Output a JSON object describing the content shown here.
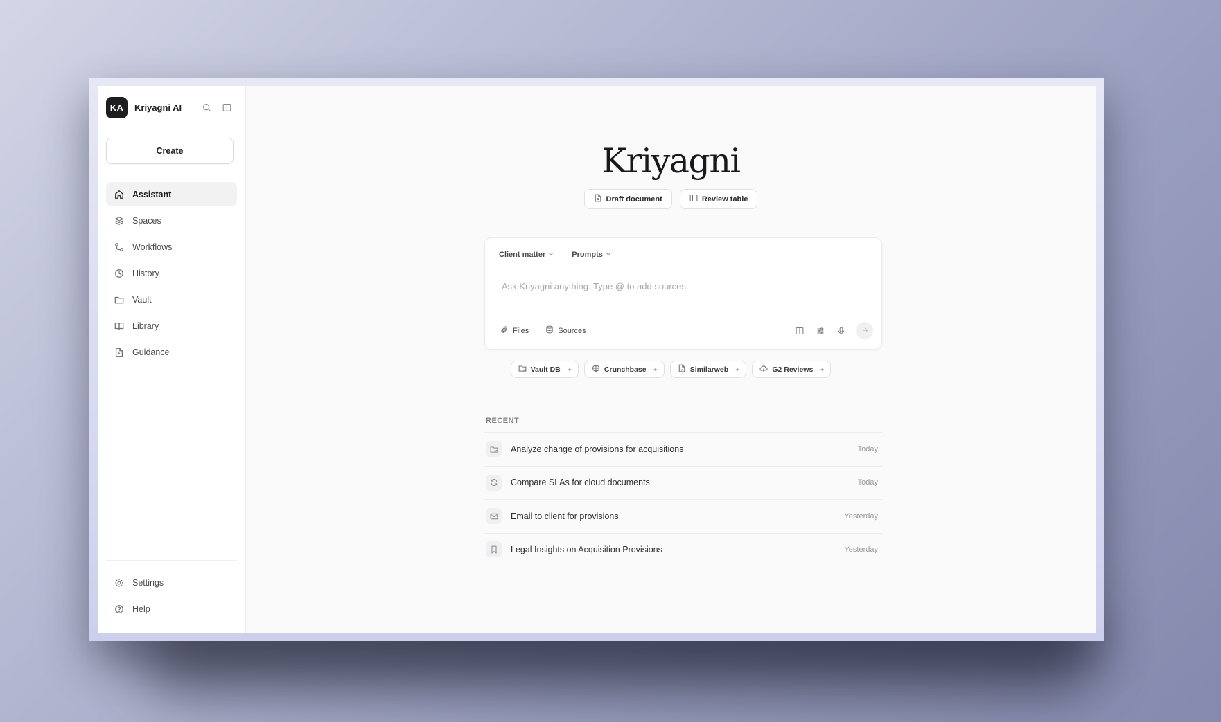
{
  "app": {
    "brand_initials": "KA",
    "brand_name": "Kriyagni AI",
    "hero_title": "Kriyagni"
  },
  "sidebar": {
    "create_label": "Create",
    "items": [
      {
        "label": "Assistant",
        "icon": "home-icon",
        "active": true
      },
      {
        "label": "Spaces",
        "icon": "layers-icon"
      },
      {
        "label": "Workflows",
        "icon": "workflow-icon"
      },
      {
        "label": "History",
        "icon": "clock-icon"
      },
      {
        "label": "Vault",
        "icon": "folder-icon"
      },
      {
        "label": "Library",
        "icon": "book-icon"
      },
      {
        "label": "Guidance",
        "icon": "file-guidance-icon"
      }
    ],
    "bottom": [
      {
        "label": "Settings",
        "icon": "gear-icon"
      },
      {
        "label": "Help",
        "icon": "help-icon"
      }
    ]
  },
  "quick_actions": [
    {
      "label": "Draft document",
      "icon": "document-icon"
    },
    {
      "label": "Review table",
      "icon": "table-icon"
    }
  ],
  "composer": {
    "client_matter": "Client matter",
    "prompts": "Prompts",
    "placeholder": "Ask Kriyagni anything. Type @ to add sources.",
    "files": "Files",
    "sources": "Sources"
  },
  "source_chips": [
    {
      "label": "Vault DB",
      "icon": "folder-icon"
    },
    {
      "label": "Crunchbase",
      "icon": "globe-icon"
    },
    {
      "label": "Similarweb",
      "icon": "file-icon"
    },
    {
      "label": "G2 Reviews",
      "icon": "cloud-icon"
    }
  ],
  "recent": {
    "heading": "RECENT",
    "items": [
      {
        "title": "Analyze change of provisions for acquisitions",
        "time": "Today",
        "icon": "folder-icon"
      },
      {
        "title": "Compare SLAs for cloud documents",
        "time": "Today",
        "icon": "refresh-icon"
      },
      {
        "title": "Email to client for provisions",
        "time": "Yesterday",
        "icon": "mail-icon"
      },
      {
        "title": "Legal Insights on Acquisition Provisions",
        "time": "Yesterday",
        "icon": "bookmark-icon"
      }
    ]
  }
}
